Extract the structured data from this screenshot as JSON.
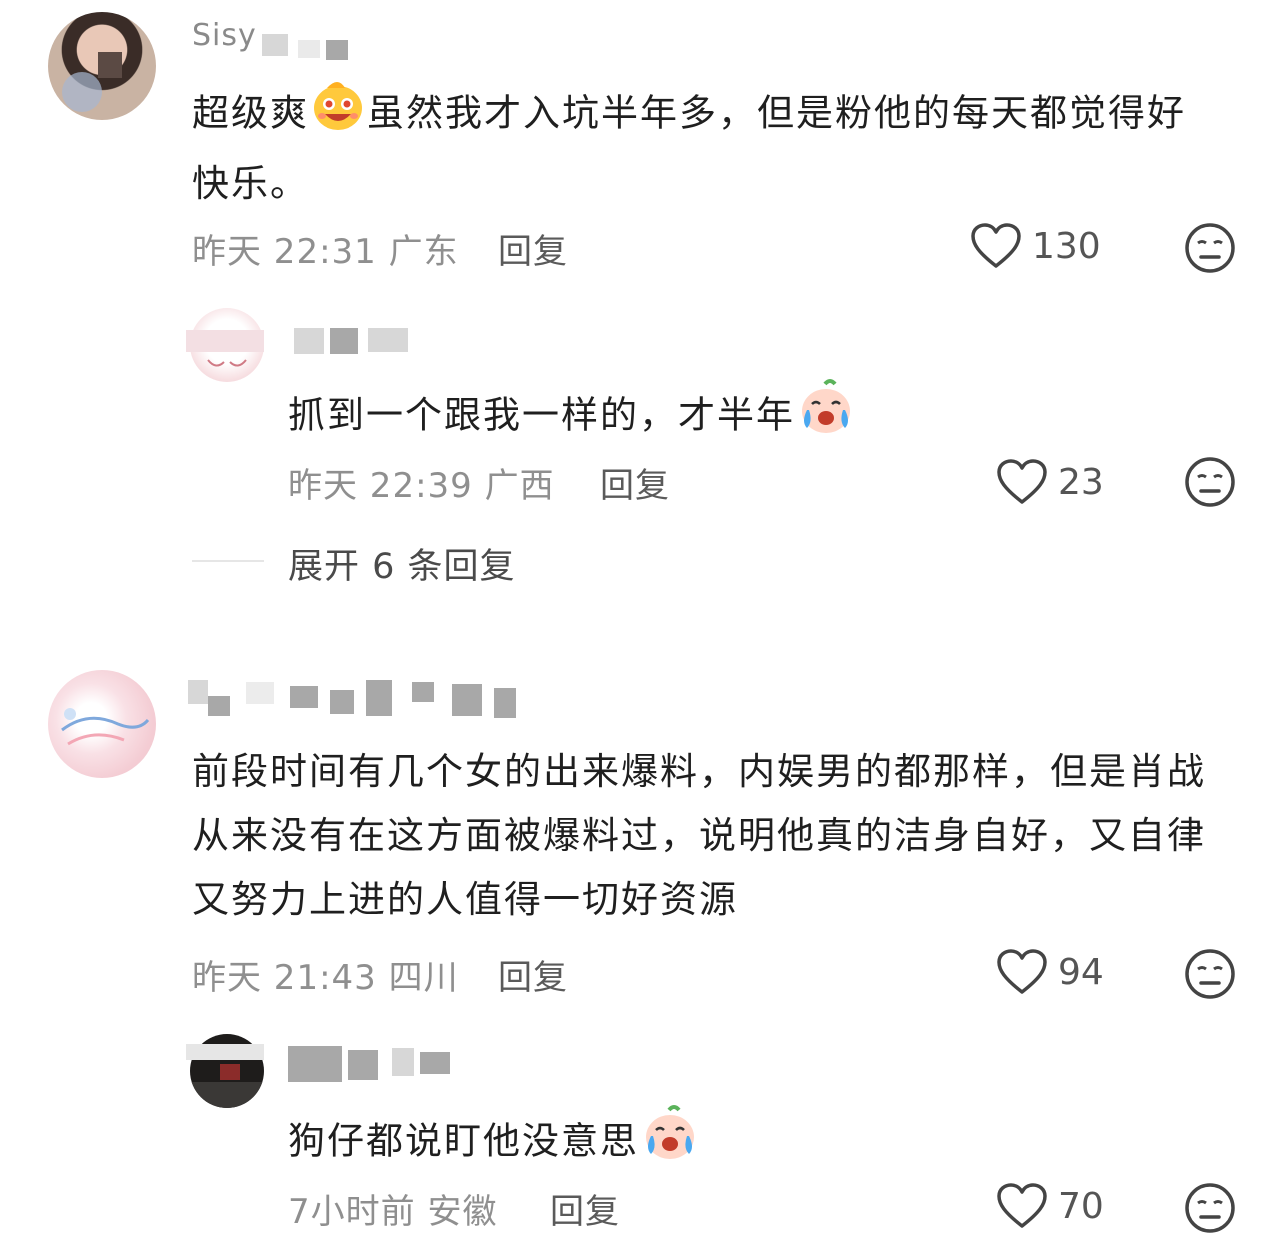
{
  "comments": [
    {
      "username": "Sisy",
      "text": "超级爽",
      "text2": "虽然我才入坑半年多，但是粉他的每天都觉得好快乐。",
      "time": "昨天 22:31",
      "location": "广东",
      "reply_label": "回复",
      "likes": "130",
      "reply": {
        "text": "抓到一个跟我一样的，才半年",
        "time": "昨天 22:39",
        "location": "广西",
        "reply_label": "回复",
        "likes": "23"
      },
      "expand_label": "展开 6 条回复"
    },
    {
      "text": "前段时间有几个女的出来爆料，内娱男的都那样，但是肖战从来没有在这方面被爆料过，说明他真的洁身自好，又自律又努力上进的人值得一切好资源",
      "time": "昨天 21:43",
      "location": "四川",
      "reply_label": "回复",
      "likes": "94",
      "reply": {
        "text": "狗仔都说盯他没意思",
        "time": "7小时前",
        "location": "安徽",
        "reply_label": "回复",
        "likes": "70"
      }
    }
  ],
  "icons": {
    "like": "heart-outline-icon",
    "dislike": "meh-face-icon",
    "emoji_happy": "grinning-emoji",
    "emoji_cry": "crying-emoji"
  }
}
